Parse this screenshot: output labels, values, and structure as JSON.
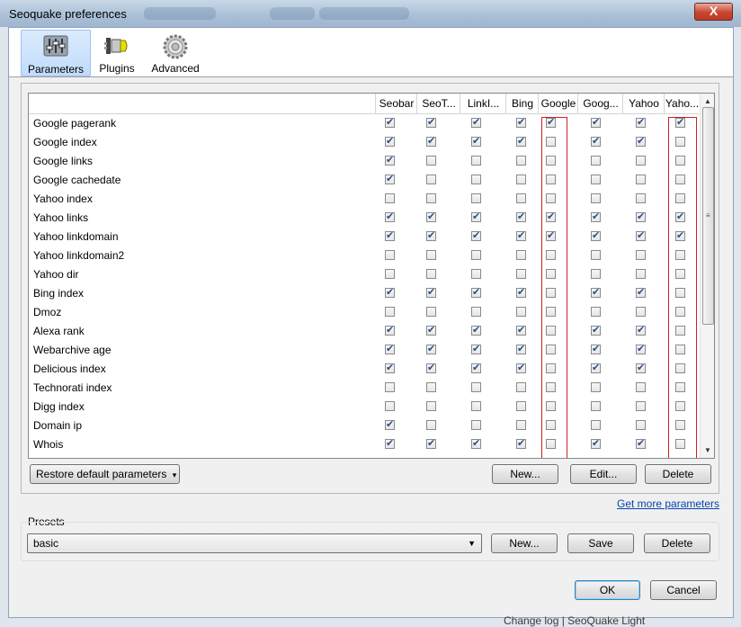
{
  "window": {
    "title": "Seoquake preferences",
    "close_glyph": "X"
  },
  "toolbar": {
    "items": [
      {
        "label": "Parameters",
        "icon": "sliders-icon",
        "active": true
      },
      {
        "label": "Plugins",
        "icon": "plug-icon",
        "active": false
      },
      {
        "label": "Advanced",
        "icon": "gear-icon",
        "active": false
      }
    ]
  },
  "table": {
    "columns": [
      "Seobar",
      "SeoT...",
      "LinkI...",
      "Bing",
      "Google",
      "Goog...",
      "Yahoo",
      "Yaho..."
    ],
    "rows": [
      {
        "label": "Google pagerank",
        "checks": [
          1,
          1,
          1,
          1,
          1,
          1,
          1,
          1
        ]
      },
      {
        "label": "Google index",
        "checks": [
          1,
          1,
          1,
          1,
          0,
          1,
          1,
          0
        ]
      },
      {
        "label": "Google links",
        "checks": [
          1,
          0,
          0,
          0,
          0,
          0,
          0,
          0
        ]
      },
      {
        "label": "Google cachedate",
        "checks": [
          1,
          0,
          0,
          0,
          0,
          0,
          0,
          0
        ]
      },
      {
        "label": "Yahoo index",
        "checks": [
          0,
          0,
          0,
          0,
          0,
          0,
          0,
          0
        ]
      },
      {
        "label": "Yahoo links",
        "checks": [
          1,
          1,
          1,
          1,
          1,
          1,
          1,
          1
        ]
      },
      {
        "label": "Yahoo linkdomain",
        "checks": [
          1,
          1,
          1,
          1,
          1,
          1,
          1,
          1
        ]
      },
      {
        "label": "Yahoo linkdomain2",
        "checks": [
          0,
          0,
          0,
          0,
          0,
          0,
          0,
          0
        ]
      },
      {
        "label": "Yahoo dir",
        "checks": [
          0,
          0,
          0,
          0,
          0,
          0,
          0,
          0
        ]
      },
      {
        "label": "Bing index",
        "checks": [
          1,
          1,
          1,
          1,
          0,
          1,
          1,
          0
        ]
      },
      {
        "label": "Dmoz",
        "checks": [
          0,
          0,
          0,
          0,
          0,
          0,
          0,
          0
        ]
      },
      {
        "label": "Alexa rank",
        "checks": [
          1,
          1,
          1,
          1,
          0,
          1,
          1,
          0
        ]
      },
      {
        "label": "Webarchive age",
        "checks": [
          1,
          1,
          1,
          1,
          0,
          1,
          1,
          0
        ]
      },
      {
        "label": "Delicious index",
        "checks": [
          1,
          1,
          1,
          1,
          0,
          1,
          1,
          0
        ]
      },
      {
        "label": "Technorati index",
        "checks": [
          0,
          0,
          0,
          0,
          0,
          0,
          0,
          0
        ]
      },
      {
        "label": "Digg index",
        "checks": [
          0,
          0,
          0,
          0,
          0,
          0,
          0,
          0
        ]
      },
      {
        "label": "Domain ip",
        "checks": [
          1,
          0,
          0,
          0,
          0,
          0,
          0,
          0
        ]
      },
      {
        "label": "Whois",
        "checks": [
          1,
          1,
          1,
          1,
          0,
          1,
          1,
          0
        ]
      }
    ]
  },
  "actions": {
    "restore_label": "Restore default parameters",
    "restore_arrow": "▾",
    "new_label": "New...",
    "edit_label": "Edit...",
    "delete_label": "Delete",
    "more_link": "Get more parameters"
  },
  "presets": {
    "group_label": "Presets",
    "selected": "basic",
    "new_label": "New...",
    "save_label": "Save",
    "delete_label": "Delete"
  },
  "dialog": {
    "ok_label": "OK",
    "cancel_label": "Cancel"
  },
  "background_text": "Change log | SeoQuake Light"
}
